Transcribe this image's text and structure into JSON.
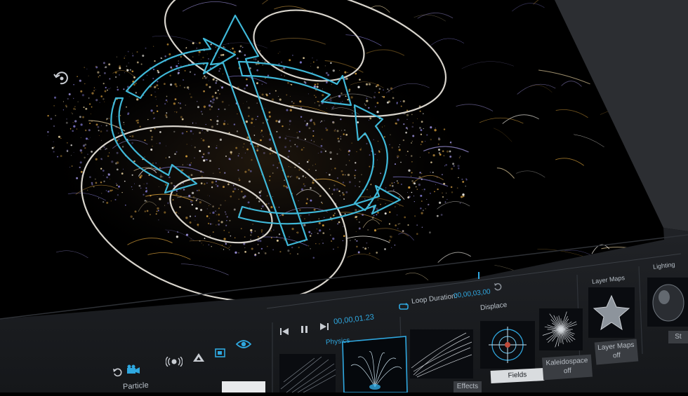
{
  "timeline": {
    "timecode": "00,00,01.23",
    "loop_label": "Loop Duration:",
    "loop_value": "00,00,03,00"
  },
  "sections": {
    "physics": "Physics",
    "displace": "Displace",
    "layer_maps": "Layer Maps",
    "lighting": "Lighting",
    "particle": "Particle"
  },
  "tiles": {
    "effects": "Effects",
    "fields": "Fields",
    "kaleidospace": "Kaleidospace",
    "kaleidospace_state": "off",
    "layer_maps": "Layer Maps",
    "layer_maps_state": "off",
    "lighting_partial": "St"
  },
  "icons": {
    "viewport_rotate": "rotate-view-icon",
    "reset": "reset-icon",
    "camera": "camera-icon",
    "audio": "audio-react-icon",
    "shape": "shape-icon",
    "layer": "layer-icon",
    "visibility": "eye-icon",
    "prev": "skip-back-icon",
    "pause": "pause-icon",
    "next": "skip-forward-icon",
    "loop": "loop-icon",
    "loop_reset": "loop-reset-icon"
  },
  "colors": {
    "accent": "#2fa8e0",
    "gizmo": "#3fb8d8",
    "ellipse": "#d8d4cc",
    "particles_gold": "#d8a03a",
    "particles_violet": "#7c74c8",
    "panel": "#1c1e22",
    "tile_active": "#d9dcdf"
  }
}
